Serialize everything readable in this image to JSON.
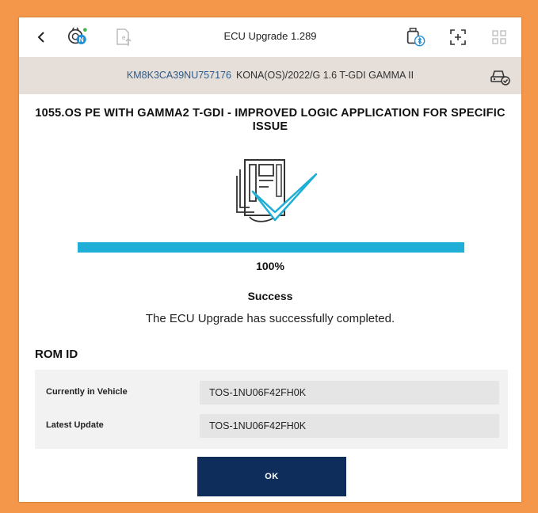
{
  "topbar": {
    "title": "ECU Upgrade 1.289",
    "icons": [
      "back-arrow-icon",
      "diagnostic-n-icon",
      "e-upload-icon",
      "vci-bluetooth-icon",
      "screen-capture-icon",
      "grid-icon"
    ]
  },
  "vehicle": {
    "vin": "KM8K3CA39NU757176",
    "description": "KONA(OS)/2022/G 1.6 T-GDI GAMMA II"
  },
  "upgrade": {
    "heading": "1055.OS PE WITH GAMMA2 T-GDI - IMPROVED LOGIC APPLICATION FOR SPECIFIC ISSUE",
    "progress_percent": 100,
    "progress_label": "100%",
    "status": "Success",
    "message": "The ECU Upgrade has successfully completed."
  },
  "rom": {
    "title": "ROM ID",
    "rows": [
      {
        "label": "Currently in Vehicle",
        "value": "TOS-1NU06F42FH0K"
      },
      {
        "label": "Latest Update",
        "value": "TOS-1NU06F42FH0K"
      }
    ]
  },
  "actions": {
    "ok_label": "OK"
  },
  "colors": {
    "accent": "#1eaed6",
    "button": "#0f2d5a",
    "badge": "#1f8fd6",
    "frame": "#f5974a",
    "vehicle_bar": "#e6dfd9"
  }
}
